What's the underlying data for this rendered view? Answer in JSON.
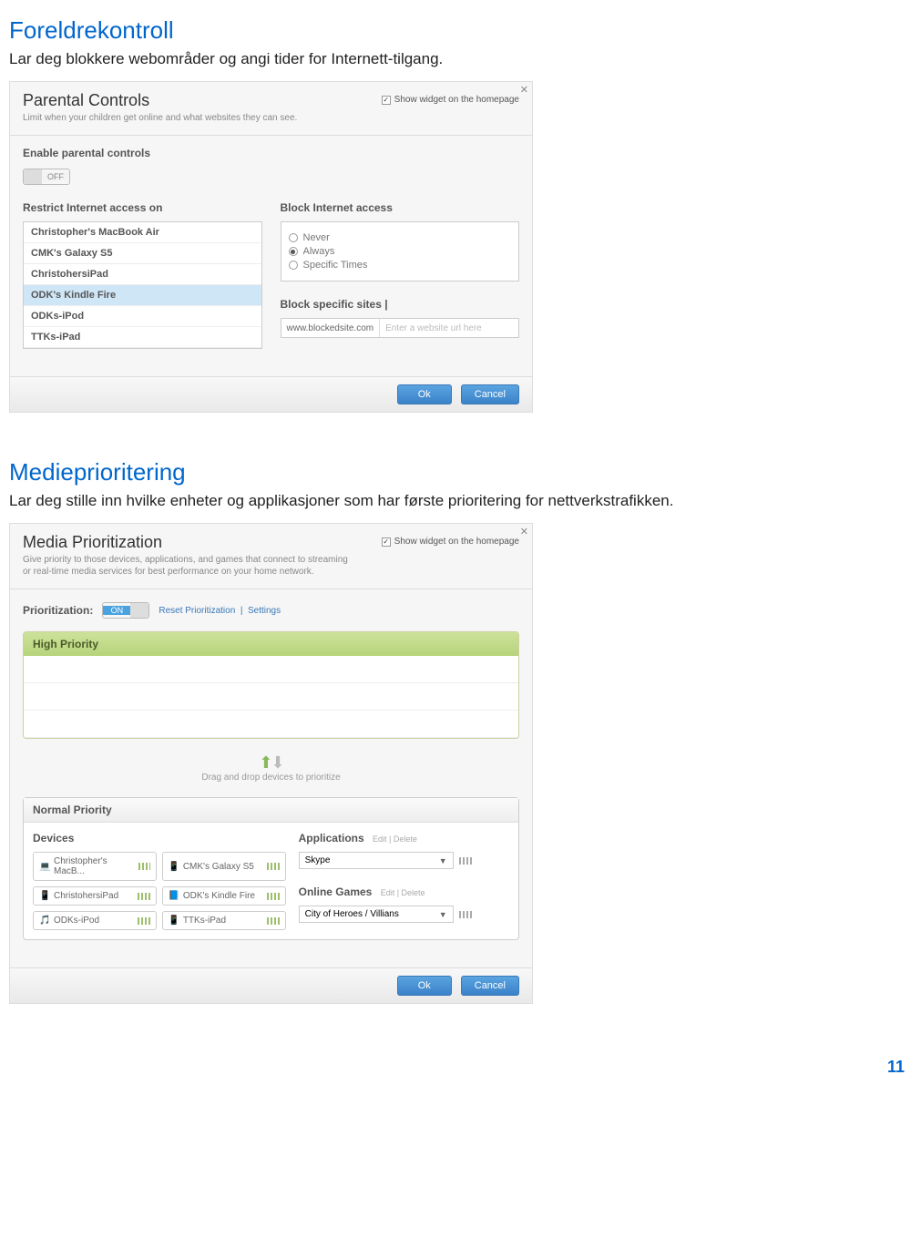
{
  "page_number": "11",
  "parental": {
    "heading": "Foreldrekontroll",
    "desc": "Lar deg blokkere webområder og angi tider for Internett-tilgang.",
    "panel_title": "Parental Controls",
    "panel_sub": "Limit when your children get online and what websites they can see.",
    "show_widget": "Show widget on the homepage",
    "enable_label": "Enable parental controls",
    "toggle_state": "OFF",
    "restrict_head": "Restrict Internet access on",
    "devices": [
      "Christopher's MacBook Air",
      "CMK's Galaxy S5",
      "ChristohersiPad",
      "ODK's Kindle Fire",
      "ODKs-iPod",
      "TTKs-iPad"
    ],
    "selected_device_index": 3,
    "block_access_head": "Block Internet access",
    "radios": [
      "Never",
      "Always",
      "Specific Times"
    ],
    "selected_radio_index": 1,
    "block_sites_head": "Block specific sites  |",
    "block_site_value": "www.blockedsite.com",
    "block_site_placeholder": "Enter a website url here",
    "ok": "Ok",
    "cancel": "Cancel"
  },
  "media": {
    "heading": "Medieprioritering",
    "desc": "Lar deg stille inn hvilke enheter og applikasjoner som har første prioritering for nettverkstrafikken.",
    "panel_title": "Media Prioritization",
    "panel_sub": "Give priority to those devices, applications, and games that connect to streaming or real-time media services for best performance on your home network.",
    "show_widget": "Show widget on the homepage",
    "prio_label": "Prioritization:",
    "toggle_state": "ON",
    "reset_link": "Reset Prioritization",
    "settings_link": "Settings",
    "high_head": "High Priority",
    "drag_hint": "Drag and drop devices to prioritize",
    "normal_head": "Normal Priority",
    "devices_head": "Devices",
    "devices": [
      "Christopher's MacB...",
      "CMK's Galaxy S5",
      "ChristohersiPad",
      "ODK's Kindle Fire",
      "ODKs-iPod",
      "TTKs-iPad"
    ],
    "apps_head": "Applications",
    "edit_del": "Edit   |   Delete",
    "app_selected": "Skype",
    "games_head": "Online Games",
    "game_selected": "City of Heroes / Villians",
    "ok": "Ok",
    "cancel": "Cancel"
  }
}
